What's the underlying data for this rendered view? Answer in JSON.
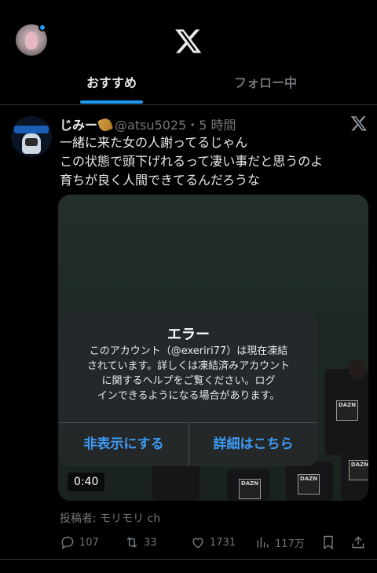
{
  "header": {
    "tabs": [
      {
        "label": "おすすめ",
        "active": true
      },
      {
        "label": "フォロー中",
        "active": false
      }
    ],
    "accent_color": "#1d9bf0"
  },
  "post": {
    "display_name": "じみー",
    "handle_time": "@atsu5025・5 時間",
    "text_lines": [
      "一緒に来た女の人謝ってるじゃん",
      "この状態で頭下げれるって凄い事だと思うのよ",
      "育ちが良く人間できてるんだろうな"
    ],
    "media": {
      "duration": "0:40",
      "dazn_logo_text": "DAZN"
    },
    "poster_credit": "投稿者: モリモリ ch",
    "stats": {
      "replies": "107",
      "reposts": "33",
      "likes": "1731",
      "views": "117万"
    }
  },
  "dialog": {
    "title": "エラー",
    "message_lines": [
      "このアカウント（@exeriri77）は現在凍結",
      "されています。詳しくは凍結済みアカウント",
      "に関するヘルプをご覧ください。ログ",
      "インできるようになる場合があります。"
    ],
    "hide_button": "非表示にする",
    "detail_button": "詳細はこちら",
    "button_color": "#3d9bf5"
  },
  "icons": {
    "logo": "x-logo-icon",
    "reply": "reply-icon",
    "repost": "repost-icon",
    "like": "heart-icon",
    "views": "views-chart-icon",
    "bookmark": "bookmark-icon",
    "share": "share-icon"
  }
}
